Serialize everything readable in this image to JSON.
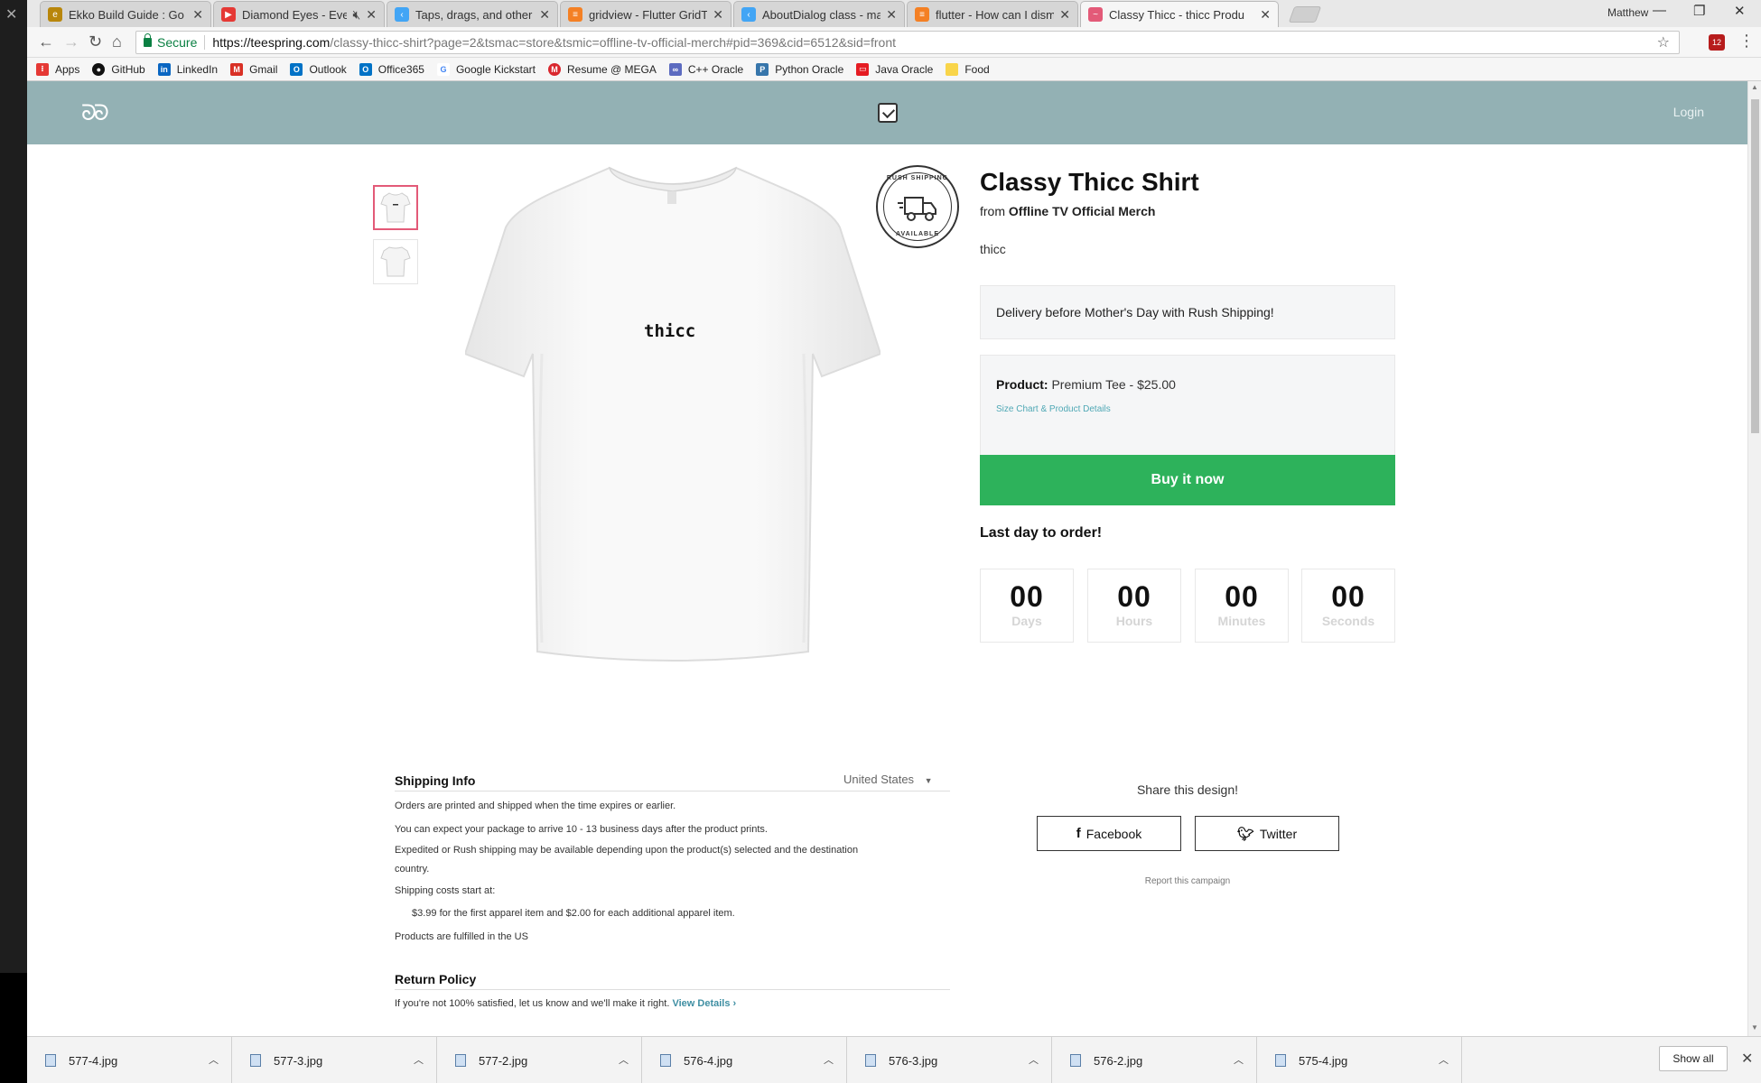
{
  "browser": {
    "tabs": [
      {
        "label": "Ekko Build Guide : Go",
        "icon_color": "#b8860b",
        "icon": "ekko-icon"
      },
      {
        "label": "Diamond Eyes - Every",
        "icon_color": "#e53935",
        "icon": "youtube-icon",
        "muted": true
      },
      {
        "label": "Taps, drags, and other ge",
        "icon_color": "#42a5f5",
        "icon": "flutter-icon"
      },
      {
        "label": "gridview - Flutter GridTile",
        "icon_color": "#f48024",
        "icon": "stackoverflow-icon"
      },
      {
        "label": "AboutDialog class - mate",
        "icon_color": "#42a5f5",
        "icon": "flutter-icon"
      },
      {
        "label": "flutter - How can I dismis",
        "icon_color": "#f48024",
        "icon": "stackoverflow-icon"
      },
      {
        "label": "Classy Thicc - thicc Produ",
        "icon_color": "#e35a78",
        "icon": "teespring-icon",
        "active": true
      }
    ],
    "user": "Matthew",
    "address": {
      "secure_label": "Secure",
      "url_scheme_host": "https://teespring.com",
      "url_path": "/classy-thicc-shirt?page=2&tsmac=store&tsmic=offline-tv-official-merch#pid=369&cid=6512&sid=front"
    },
    "extension_badge": "12",
    "bookmarks": [
      {
        "label": "Apps",
        "color": "#e53935"
      },
      {
        "label": "GitHub",
        "color": "#111111"
      },
      {
        "label": "LinkedIn",
        "color": "#0a66c2"
      },
      {
        "label": "Gmail",
        "color": "#d93025"
      },
      {
        "label": "Outlook",
        "color": "#0072c6"
      },
      {
        "label": "Office365",
        "color": "#0072c6"
      },
      {
        "label": "Google Kickstart",
        "color": "#4285f4"
      },
      {
        "label": "Resume @ MEGA",
        "color": "#d9272e"
      },
      {
        "label": "C++ Oracle",
        "color": "#5c6bc0"
      },
      {
        "label": "Python Oracle",
        "color": "#3776ab"
      },
      {
        "label": "Java Oracle",
        "color": "#e51c23"
      },
      {
        "label": "Food",
        "color": "#f9d54a"
      }
    ]
  },
  "site": {
    "login_label": "Login",
    "brand_color": "#93b1b4"
  },
  "product": {
    "title": "Classy Thicc Shirt",
    "from_prefix": "from",
    "seller": "Offline TV Official Merch",
    "description": "thicc",
    "shirt_print": "thicc",
    "badge_top": "RUSH SHIPPING",
    "badge_bottom": "AVAILABLE",
    "delivery_note": "Delivery before Mother's Day with Rush Shipping!",
    "product_label": "Product:",
    "product_value": "Premium Tee - $25.00",
    "size_link": "Size Chart & Product Details",
    "buy_label": "Buy it now",
    "last_day": "Last day to order!",
    "countdown": [
      {
        "value": "00",
        "label": "Days"
      },
      {
        "value": "00",
        "label": "Hours"
      },
      {
        "value": "00",
        "label": "Minutes"
      },
      {
        "value": "00",
        "label": "Seconds"
      }
    ]
  },
  "shipping": {
    "title": "Shipping Info",
    "country": "United States",
    "lines": [
      "Orders are printed and shipped when the time expires or earlier.",
      "You can expect your package to arrive 10 - 13 business days after the product prints.",
      "Expedited or Rush shipping may be available depending upon the product(s) selected and the destination",
      "country.",
      "Shipping costs start at:",
      "$3.99 for the first apparel item and $2.00 for each additional apparel item.",
      "Products are fulfilled in the US"
    ],
    "return_title": "Return Policy",
    "return_text": "If you're not 100% satisfied, let us know and we'll make it right.",
    "return_link": "View Details ›"
  },
  "share": {
    "title": "Share this design!",
    "facebook": "Facebook",
    "twitter": "Twitter",
    "report": "Report this campaign"
  },
  "downloads": {
    "items": [
      "577-4.jpg",
      "577-3.jpg",
      "577-2.jpg",
      "576-4.jpg",
      "576-3.jpg",
      "576-2.jpg",
      "575-4.jpg"
    ],
    "show_all": "Show all"
  }
}
